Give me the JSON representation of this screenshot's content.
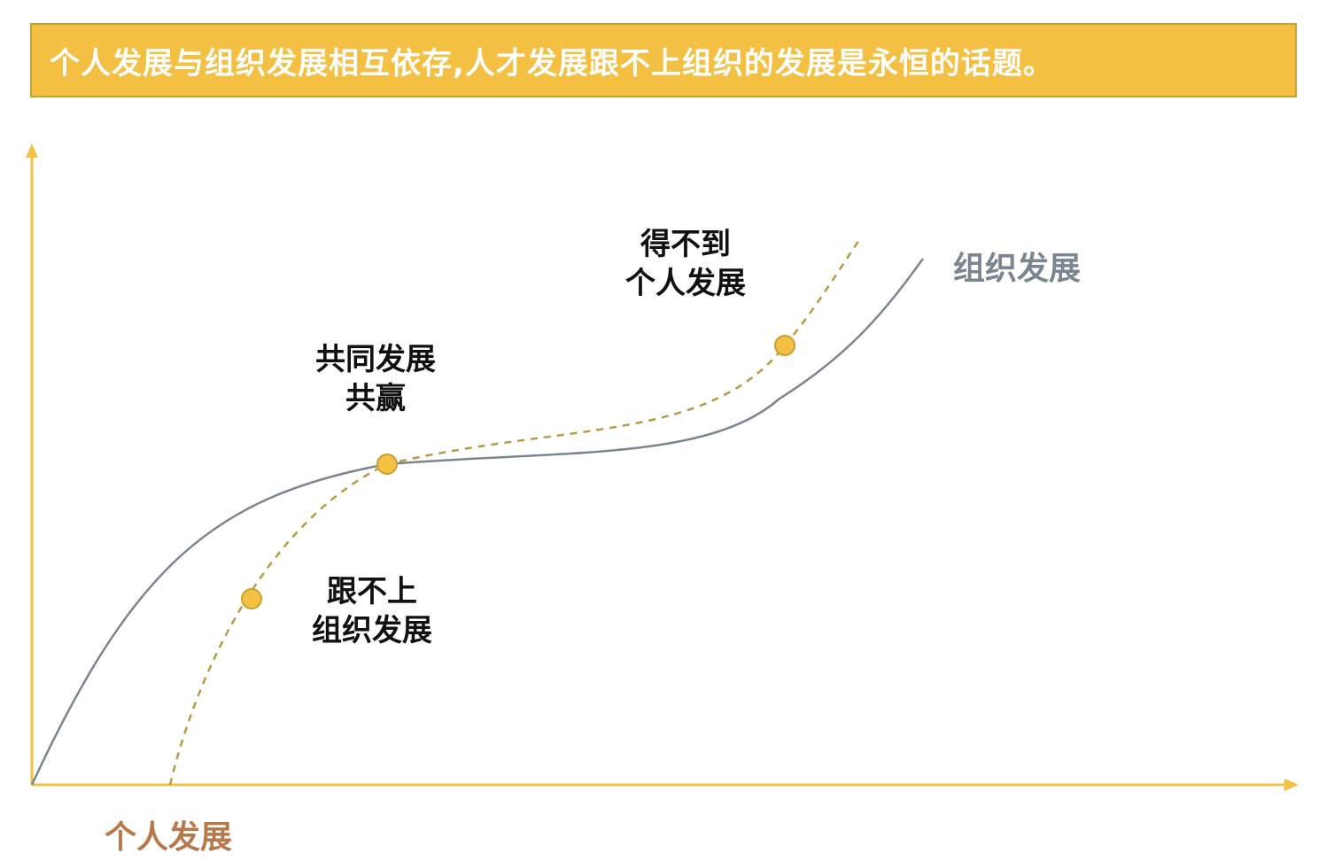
{
  "header": {
    "title": "个人发展与组织发展相互依存,人才发展跟不上组织的发展是永恒的话题。"
  },
  "curves": {
    "organization": {
      "label": "组织发展",
      "color": "#7b8591",
      "style": "solid"
    },
    "individual": {
      "label": "个人发展",
      "color": "#b8794a",
      "stroke_color": "#b89a44",
      "style": "dashed"
    }
  },
  "annotations": {
    "lagging": {
      "line1": "跟不上",
      "line2": "组织发展"
    },
    "win_win": {
      "line1": "共同发展",
      "line2": "共赢"
    },
    "not_enough": {
      "line1": "得不到",
      "line2": "个人发展"
    }
  },
  "colors": {
    "banner_bg": "#f4c043",
    "banner_border": "#c9a02c",
    "axis": "#f4c043",
    "marker_fill": "#f4c043",
    "marker_stroke": "#c9a02c"
  }
}
